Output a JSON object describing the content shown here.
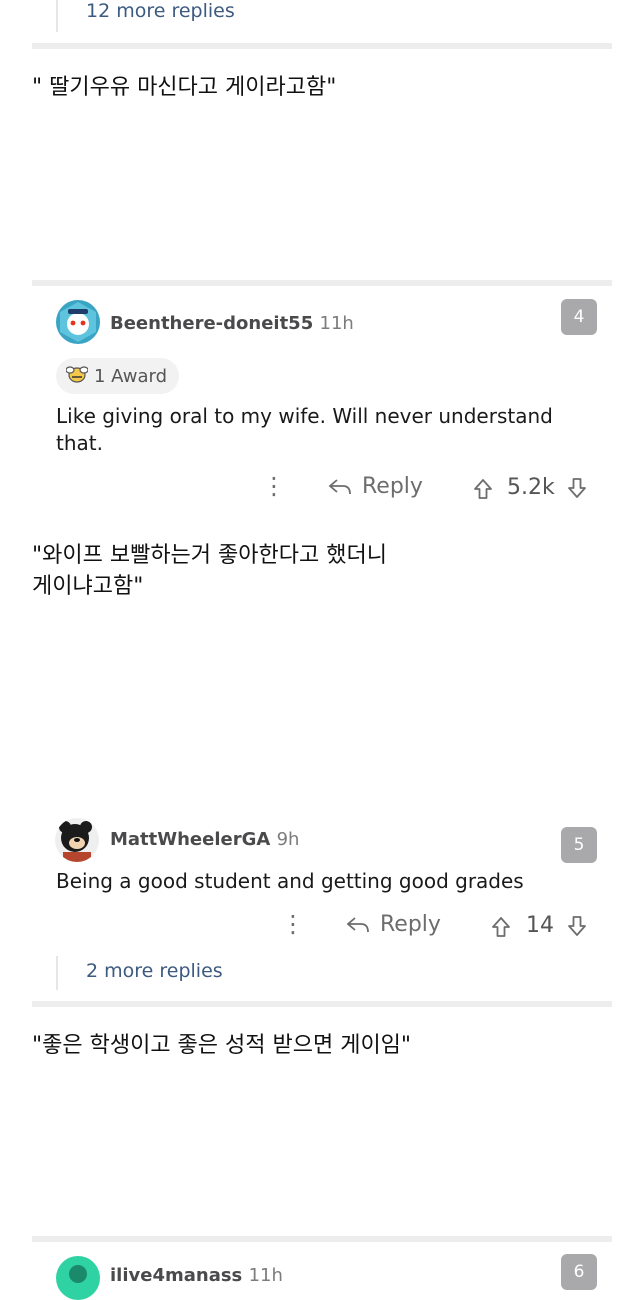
{
  "top": {
    "more_replies": "12 more replies"
  },
  "captions": {
    "c1": "\" 딸기우유 마신다고 게이라고함\"",
    "c2": "\"와이프 보빨하는거 좋아한다고 했더니\n게이냐고함\"",
    "c3": "\"좋은 학생이고 좋은 성적 받으면 게이임\""
  },
  "comments": [
    {
      "username": "Beenthere-doneit55",
      "time": "11h",
      "rank": "4",
      "award": "1 Award",
      "body": "Like giving oral to my wife.  Will never understand that.",
      "reply_label": "Reply",
      "votes": "5.2k"
    },
    {
      "username": "MattWheelerGA",
      "time": "9h",
      "rank": "5",
      "body": "Being a good student and getting good grades",
      "reply_label": "Reply",
      "votes": "14",
      "more_replies": "2 more replies"
    },
    {
      "username": "ilive4manass",
      "time": "11h",
      "rank": "6"
    }
  ],
  "colors": {
    "link": "#3d5a80",
    "badge": "#a9a9ab",
    "divider": "#ededed"
  }
}
